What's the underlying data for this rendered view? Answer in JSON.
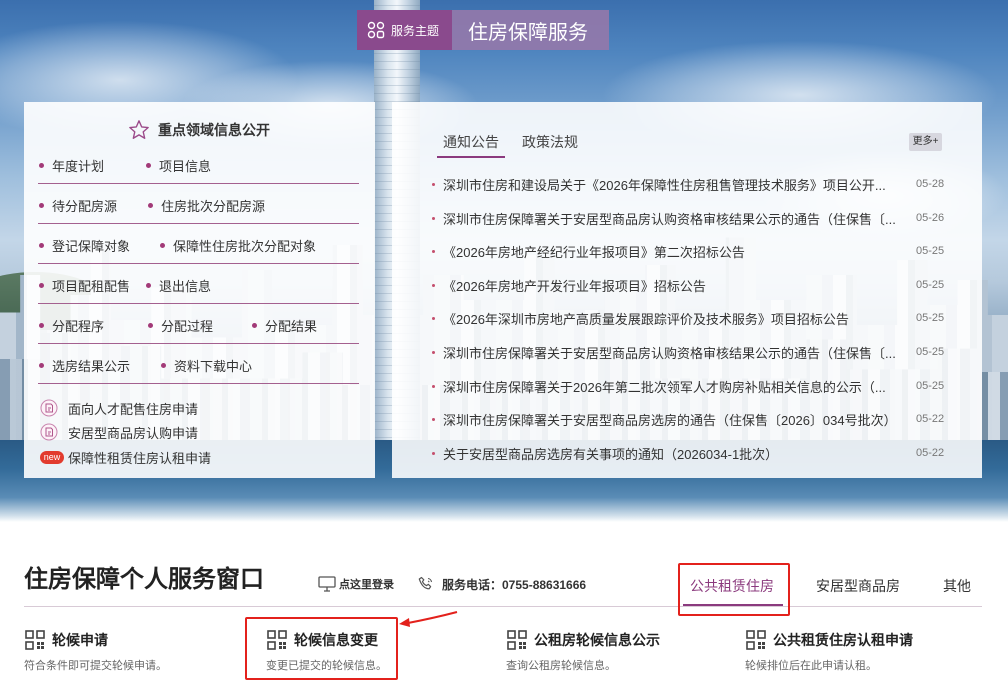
{
  "header": {
    "theme_label": "服务主题",
    "title": "住房保障服务",
    "theme_icon": "grid-circles-icon"
  },
  "key_info": {
    "title": "重点领域信息公开",
    "icon": "star-icon",
    "rows": [
      [
        "年度计划",
        "项目信息"
      ],
      [
        "待分配房源",
        "住房批次分配房源"
      ],
      [
        "登记保障对象",
        "保障性住房批次分配对象"
      ],
      [
        "项目配租配售",
        "退出信息"
      ],
      [
        "分配程序",
        "分配过程",
        "分配结果"
      ],
      [
        "选房结果公示",
        "资料下载中心"
      ]
    ],
    "apply_links": [
      {
        "label": "面向人才配售住房申请",
        "icon": "document-circle-icon"
      },
      {
        "label": "安居型商品房认购申请",
        "icon": "document-circle-icon"
      },
      {
        "label": "保障性租赁住房认租申请",
        "icon": "new-badge",
        "badge": "new"
      }
    ]
  },
  "news": {
    "tabs": [
      {
        "label": "通知公告",
        "active": true
      },
      {
        "label": "政策法规",
        "active": false
      }
    ],
    "more_label": "更多+",
    "items": [
      {
        "title": "深圳市住房和建设局关于《2026年保障性住房租售管理技术服务》项目公开...",
        "date": "05-28"
      },
      {
        "title": "深圳市住房保障署关于安居型商品房认购资格审核结果公示的通告（住保售〔...",
        "date": "05-26"
      },
      {
        "title": "《2026年房地产经纪行业年报项目》第二次招标公告",
        "date": "05-25"
      },
      {
        "title": "《2026年房地产开发行业年报项目》招标公告",
        "date": "05-25"
      },
      {
        "title": "《2026年深圳市房地产高质量发展跟踪评价及技术服务》项目招标公告",
        "date": "05-25"
      },
      {
        "title": "深圳市住房保障署关于安居型商品房认购资格审核结果公示的通告（住保售〔...",
        "date": "05-25"
      },
      {
        "title": "深圳市住房保障署关于2026年第二批次领军人才购房补贴相关信息的公示（...",
        "date": "05-25"
      },
      {
        "title": "深圳市住房保障署关于安居型商品房选房的通告（住保售〔2026〕034号批次）",
        "date": "05-22"
      },
      {
        "title": "关于安居型商品房选房有关事项的通知（2026034-1批次）",
        "date": "05-22"
      }
    ]
  },
  "service_window": {
    "title": "住房保障个人服务窗口",
    "login_label": "点这里登录",
    "login_icon": "monitor-icon",
    "phone_label": "服务电话：0755-88631666",
    "phone_icon": "phone-icon",
    "tabs": [
      {
        "label": "公共租赁住房",
        "active": true
      },
      {
        "label": "安居型商品房",
        "active": false
      },
      {
        "label": "其他",
        "active": false
      }
    ],
    "services": [
      {
        "title": "轮候申请",
        "desc": "符合条件即可提交轮候申请。",
        "icon": "service-grid-icon"
      },
      {
        "title": "轮候信息变更",
        "desc": "变更已提交的轮候信息。",
        "icon": "service-grid-icon"
      },
      {
        "title": "公租房轮候信息公示",
        "desc": "查询公租房轮候信息。",
        "icon": "service-grid-icon"
      },
      {
        "title": "公共租赁住房认租申请",
        "desc": "轮候排位后在此申请认租。",
        "icon": "service-grid-icon"
      }
    ]
  },
  "colors": {
    "accent_purple": "#8b3a7e",
    "theme_tag": "#8a4a8d",
    "bullet": "#a23a78",
    "news_bullet": "#c44f6d",
    "new_badge": "#e23b2e",
    "annotation_red": "#e3211c"
  }
}
